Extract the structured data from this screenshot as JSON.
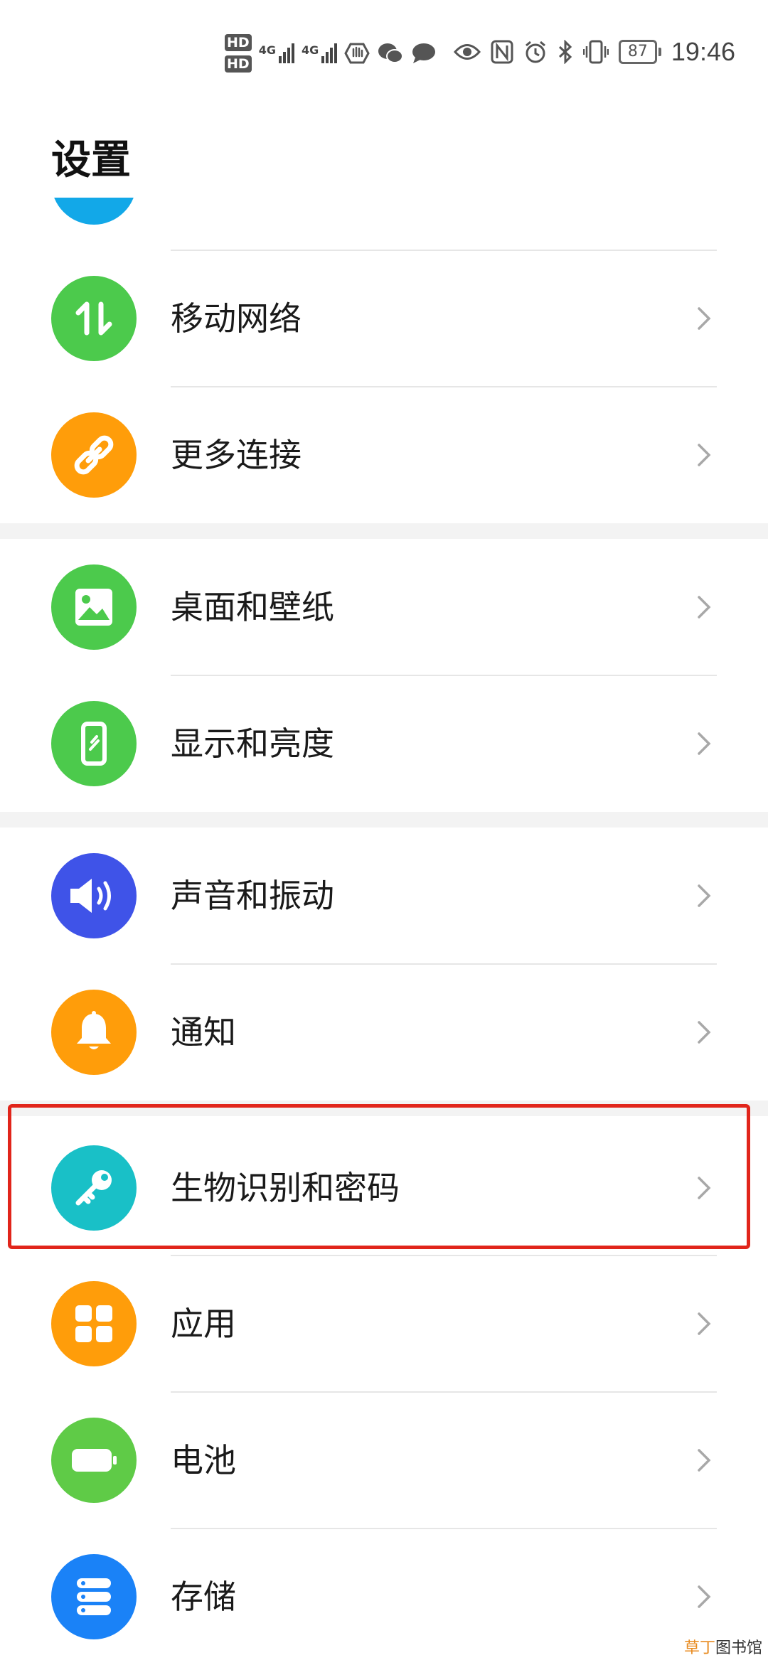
{
  "status_bar": {
    "hd1": "HD",
    "hd2": "HD",
    "net1": "4G",
    "net2": "4G",
    "battery_level": "87",
    "time": "19:46"
  },
  "page": {
    "title": "设置"
  },
  "settings": [
    {
      "label": "移动网络",
      "icon": "mobile-data-arrows-icon",
      "color": "#4cca4c"
    },
    {
      "label": "更多连接",
      "icon": "link-icon",
      "color": "#ff9d0a"
    },
    {
      "label": "桌面和壁纸",
      "icon": "image-icon",
      "color": "#4cca4c"
    },
    {
      "label": "显示和亮度",
      "icon": "phone-screen-icon",
      "color": "#4cca4c"
    },
    {
      "label": "声音和振动",
      "icon": "speaker-icon",
      "color": "#3f53e8"
    },
    {
      "label": "通知",
      "icon": "bell-icon",
      "color": "#ff9d0a"
    },
    {
      "label": "生物识别和密码",
      "icon": "key-icon",
      "color": "#19c0c7"
    },
    {
      "label": "应用",
      "icon": "apps-grid-icon",
      "color": "#ff9d0a"
    },
    {
      "label": "电池",
      "icon": "battery-icon",
      "color": "#5fcb47"
    },
    {
      "label": "存储",
      "icon": "storage-icon",
      "color": "#1a82f7"
    }
  ],
  "watermark": {
    "part1": "草丁",
    "part2": "图书馆"
  }
}
